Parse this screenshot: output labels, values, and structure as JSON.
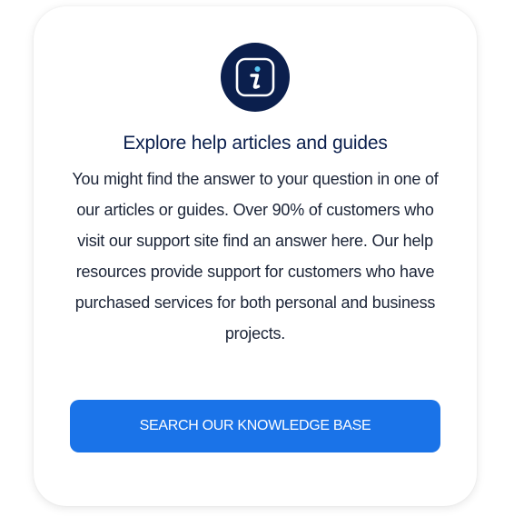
{
  "card": {
    "icon": "info-icon",
    "title": "Explore help articles and guides",
    "body": "You might find the answer to your question in one of our articles or guides. Over 90% of customers who visit our support site find an answer here. Our help resources provide support for customers who have purchased services for both personal and business projects.",
    "cta_label": "SEARCH OUR KNOWLEDGE BASE"
  },
  "colors": {
    "icon_background": "#0b1f4d",
    "icon_accent": "#5bc8f5",
    "title_text": "#0b1f4d",
    "body_text": "#1b2437",
    "button_background": "#1a73e8",
    "button_text": "#ffffff"
  }
}
